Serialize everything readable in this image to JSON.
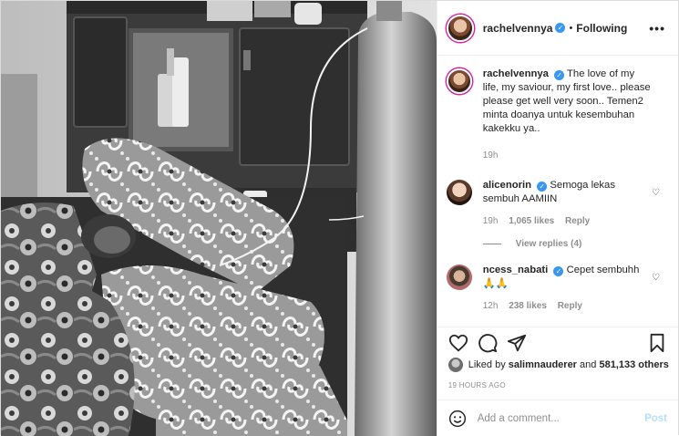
{
  "header": {
    "username": "rachelvennya",
    "separator": "•",
    "follow_label": "Following",
    "more_label": "•••"
  },
  "caption": {
    "username": "rachelvennya",
    "text": "The love of my life, my saviour, my first love.. please please get well very soon.. Temen2 minta doanya untuk kesembuhan kakekku ya..",
    "time": "19h"
  },
  "comments": [
    {
      "username": "alicenorin",
      "text": "Semoga lekas sembuh AAMIIN",
      "time": "19h",
      "likes": "1,065 likes",
      "reply_label": "Reply"
    },
    {
      "username": "ncess_nabati",
      "text": "Cepet sembuhh 🙏🙏",
      "time": "12h",
      "likes": "238 likes",
      "reply_label": "Reply"
    }
  ],
  "view_replies": "View replies (4)",
  "likes": {
    "prefix": "Liked by",
    "user": "salimnauderer",
    "middle": "and",
    "others": "581,133 others"
  },
  "timestamp": "19 HOURS AGO",
  "add_comment": {
    "placeholder": "Add a comment...",
    "post_label": "Post"
  },
  "icons": {
    "like": "heart-icon",
    "comment": "comment-icon",
    "share": "share-icon",
    "save": "bookmark-icon",
    "emoji": "emoji-icon",
    "verified": "verified-badge-icon"
  },
  "colors": {
    "verified": "#3897f0",
    "post_disabled": "#b2dffc",
    "muted": "#8e8e8e"
  }
}
